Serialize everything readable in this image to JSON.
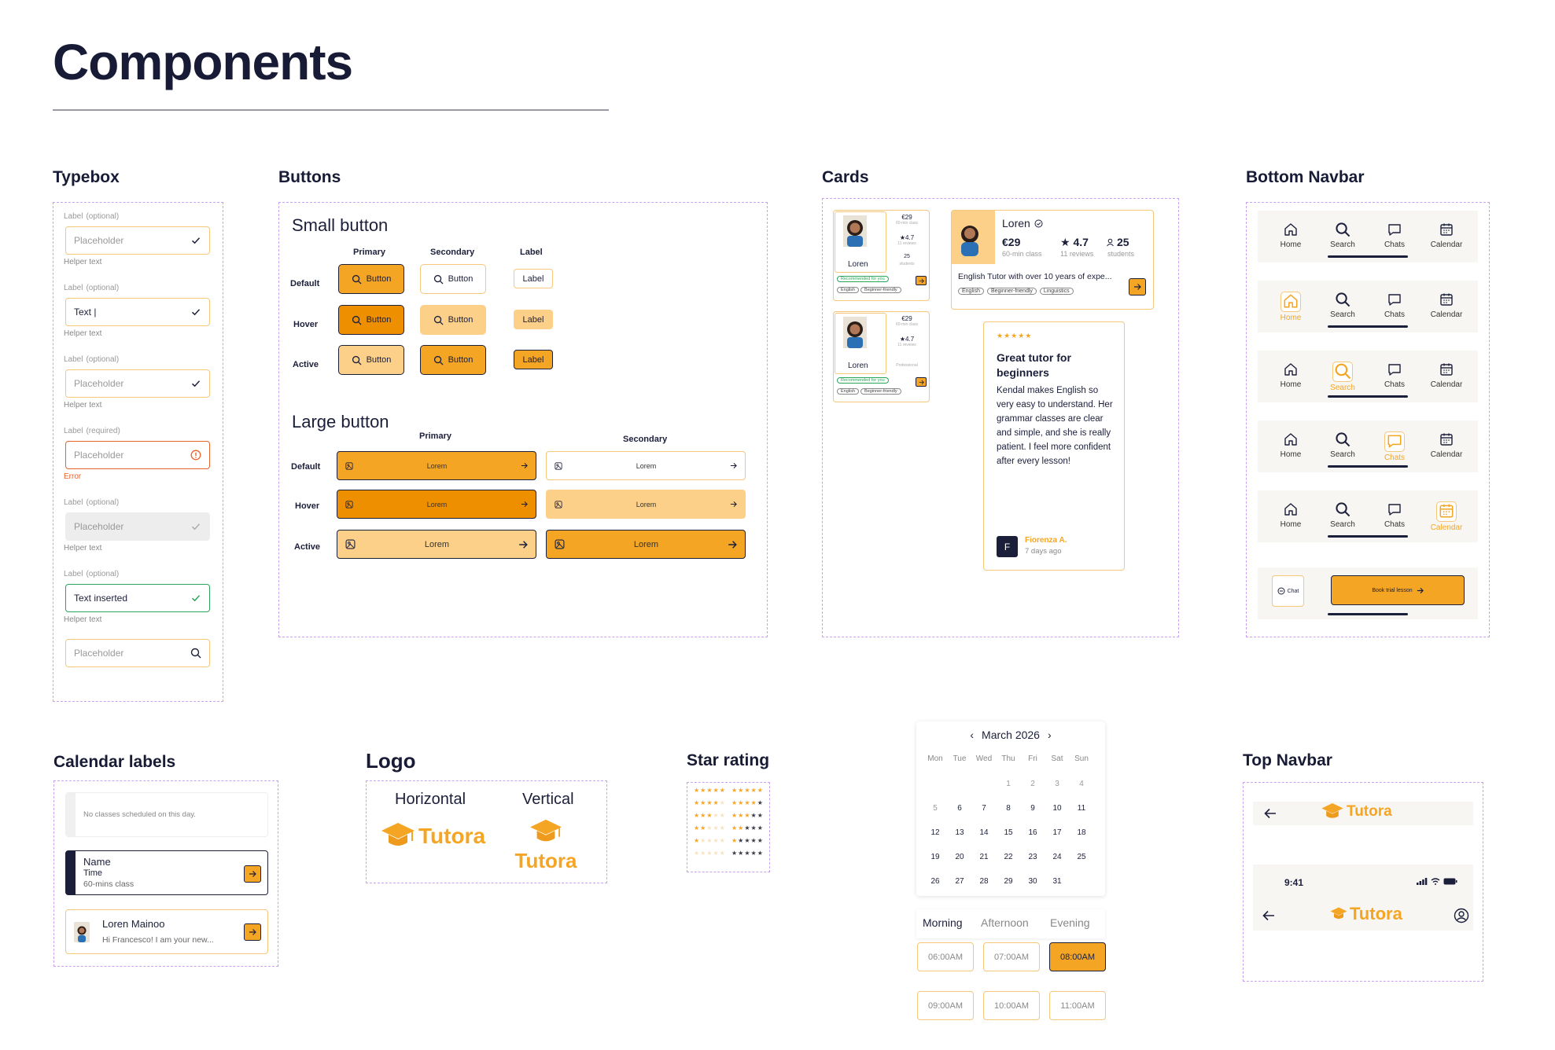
{
  "page": {
    "title": "Components"
  },
  "sections": {
    "typebox": "Typebox",
    "buttons": "Buttons",
    "cards": "Cards",
    "bottom_navbar": "Bottom Navbar",
    "calendar_labels": "Calendar labels",
    "logo": "Logo",
    "star_rating": "Star rating",
    "top_navbar": "Top Navbar"
  },
  "colors": {
    "accent": "#f5a524",
    "accent_dark": "#ee8f00",
    "accent_light": "#fcd089",
    "navy": "#1c1f3a",
    "error": "#e8622a",
    "success": "#2aa65a",
    "dashed": "#c8a2f0"
  },
  "typebox": {
    "fields": [
      {
        "label": "Label",
        "hint": "(optional)",
        "value": "Placeholder",
        "helper": "Helper text",
        "state": "default",
        "icon": "check-icon"
      },
      {
        "label": "Label",
        "hint": "(optional)",
        "value": "Text |",
        "helper": "Helper text",
        "state": "typing",
        "icon": "check-icon"
      },
      {
        "label": "Label",
        "hint": "(optional)",
        "value": "Placeholder",
        "helper": "Helper text",
        "state": "default",
        "icon": "check-icon"
      },
      {
        "label": "Label",
        "hint": "(required)",
        "value": "Placeholder",
        "helper": "Error",
        "state": "error",
        "icon": "alert-icon"
      },
      {
        "label": "Label",
        "hint": "(optional)",
        "value": "Placeholder",
        "helper": "Helper text",
        "state": "disabled",
        "icon": "check-icon"
      },
      {
        "label": "Label",
        "hint": "(optional)",
        "value": "Text inserted",
        "helper": "Helper text",
        "state": "success",
        "icon": "check-icon"
      }
    ],
    "search": {
      "placeholder": "Placeholder",
      "icon": "search-icon"
    }
  },
  "buttons": {
    "small_title": "Small button",
    "large_title": "Large button",
    "cols": {
      "primary": "Primary",
      "secondary": "Secondary",
      "label": "Label"
    },
    "rows": {
      "default": "Default",
      "hover": "Hover",
      "active": "Active"
    },
    "small_text": "Button",
    "label_text": "Label",
    "large_text": "Lorem"
  },
  "cards": {
    "mini": [
      {
        "name": "Loren",
        "price": "€29",
        "price_sub": "60-min class",
        "rating": "★4.7",
        "rating_sub": "11 reviews",
        "third": "25",
        "third_sub": "students",
        "badge": "Recommended for you",
        "tags": [
          "English",
          "Beginner-friendly"
        ]
      },
      {
        "name": "Loren",
        "price": "€29",
        "price_sub": "60-min class",
        "rating": "★4.7",
        "rating_sub": "11 reviews",
        "third": "",
        "third_sub": "Professional",
        "badge": "Recommended for you",
        "tags": [
          "English",
          "Beginner-friendly"
        ]
      }
    ],
    "wide": {
      "name": "Loren",
      "price": "€29",
      "price_sub": "60-min class",
      "rating": "★ 4.7",
      "rating_sub": "11 reviews",
      "students": "25",
      "students_sub": "students",
      "desc": "English Tutor with over 10 years of expe...",
      "tags": [
        "English",
        "Beginner-friendly",
        "Linguistics"
      ]
    },
    "review": {
      "stars": "★★★★★",
      "title": "Great tutor for beginners",
      "body": "Kendal makes English so very easy to understand. Her grammar classes are clear and simple, and she is really patient. I feel more confident after every lesson!",
      "avatar": "F",
      "author": "Fiorenza A.",
      "when": "7 days ago"
    }
  },
  "bottom_navbar": {
    "items": [
      "Home",
      "Search",
      "Chats",
      "Calendar"
    ],
    "chat_label": "Chat",
    "cta": "Book trial lesson"
  },
  "calendar_labels": {
    "empty": "No classes scheduled on this day.",
    "item1": {
      "name": "Name",
      "time": "Time",
      "sub": "60-mins class"
    },
    "item2": {
      "name": "Loren Mainoo",
      "msg": "Hi Francesco! I am your new..."
    }
  },
  "logo": {
    "horizontal": "Horizontal",
    "vertical": "Vertical",
    "brand": "Tutora"
  },
  "star_rating": {
    "levels": [
      5,
      4,
      3,
      2,
      1,
      0
    ]
  },
  "calendar": {
    "month": "March 2026",
    "weekdays": [
      "Mon",
      "Tue",
      "Wed",
      "Thu",
      "Fri",
      "Sat",
      "Sun"
    ],
    "weeks": [
      [
        "",
        "",
        "",
        "1",
        "2",
        "3",
        "4"
      ],
      [
        "5",
        "6",
        "7",
        "8",
        "9",
        "10",
        "11"
      ],
      [
        "12",
        "13",
        "14",
        "15",
        "16",
        "17",
        "18"
      ],
      [
        "19",
        "20",
        "21",
        "22",
        "23",
        "24",
        "25"
      ],
      [
        "26",
        "27",
        "28",
        "29",
        "30",
        "31",
        ""
      ]
    ],
    "periods": [
      "Morning",
      "Afternoon",
      "Evening"
    ],
    "slots": [
      "06:00AM",
      "07:00AM",
      "08:00AM",
      "09:00AM",
      "10:00AM",
      "11:00AM"
    ],
    "selected_slot": "08:00AM"
  },
  "top_navbar": {
    "brand": "Tutora",
    "time": "9:41"
  }
}
